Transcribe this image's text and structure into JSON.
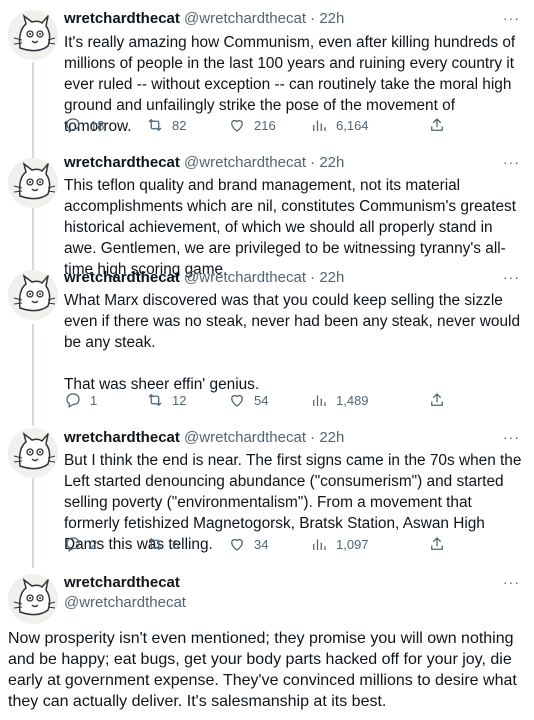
{
  "author": {
    "name": "wretchardthecat",
    "handle": "@wretchardthecat",
    "avatar_icon": "cartoon-cat-avatar-icon"
  },
  "more_label": "···",
  "dot": "·",
  "tweets": [
    {
      "time": "22h",
      "text": "It's really amazing how Communism, even after killing hundreds of millions of people in the last 100 years and ruining every country it ever ruled -- without exception -- can routinely take the moral high ground and unfailingly strike the pose of the movement of tomorrow.",
      "stats": {
        "replies": "18",
        "retweets": "82",
        "likes": "216",
        "views": "6,164"
      }
    },
    {
      "time": "22h",
      "text": "This teflon quality and brand management, not its material accomplishments which are nil, constitutes Communism's greatest historical achievement, of which we should all properly stand in awe. Gentlemen, we are privileged to be witnessing tyranny's all-time high scoring game."
    },
    {
      "time": "22h",
      "text": "What Marx discovered was that you could keep selling the sizzle even if there was no steak, never had been any steak, never would be any steak.",
      "text2": "That was sheer effin' genius.",
      "stats": {
        "replies": "1",
        "retweets": "12",
        "likes": "54",
        "views": "1,489"
      }
    },
    {
      "time": "22h",
      "text": "But I think the end is near. The first signs came in the 70s when the Left started denouncing abundance (\"consumerism\") and started selling poverty (\"environmentalism\"). From a movement that formerly fetishized Magnetogorsk, Bratsk Station, Aswan High Dams this was telling.",
      "stats": {
        "replies": "2",
        "retweets": "6",
        "likes": "34",
        "views": "1,097"
      }
    }
  ],
  "main_tweet": {
    "text": "Now prosperity isn't even mentioned; they promise you will own nothing and be happy; eat bugs, get your body parts hacked off for your joy, die early at government expense. They've convinced millions to desire what they can actually deliver. It's salesmanship at its best."
  },
  "icons": {
    "reply": "reply-icon",
    "retweet": "retweet-icon",
    "like": "heart-icon",
    "views": "views-icon",
    "share": "share-icon"
  },
  "colors": {
    "text": "#0f1419",
    "secondary": "#536471",
    "thread_line": "#cfd9de"
  }
}
